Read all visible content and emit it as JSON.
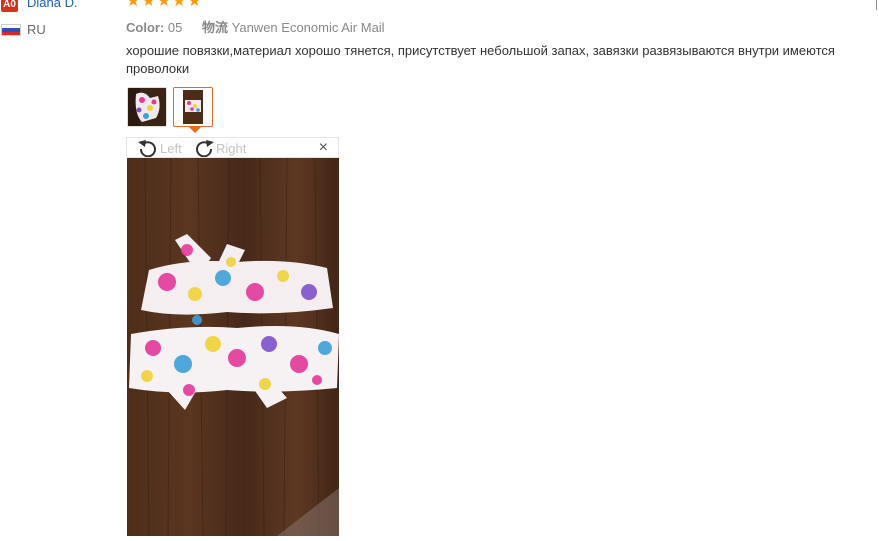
{
  "review": {
    "user": {
      "level_badge": "A0",
      "name": "Diana D.",
      "country": "RU"
    },
    "rating": 5,
    "meta": {
      "color_label": "Color:",
      "color_value": "05",
      "shipping_label": "物流",
      "shipping_value": "Yanwen Economic Air Mail"
    },
    "text": "хорошие повязки,материал хорошо тянется, присутствует небольшой запах, завязки развязываются внутри имеются проволоки",
    "thumbnails": [
      {
        "name": "photo-1",
        "selected": false
      },
      {
        "name": "photo-2",
        "selected": true
      }
    ],
    "viewer": {
      "rotate_left_label": "Left",
      "rotate_right_label": "Right",
      "close_glyph": "×"
    }
  },
  "colors": {
    "star": "#ff9a0e",
    "badge": "#d2321e",
    "username": "#1a5fb4",
    "selected_border": "#e56b1f"
  },
  "icons": [
    "star-icon",
    "russia-flag-icon",
    "rotate-left-icon",
    "rotate-right-icon",
    "close-icon"
  ]
}
